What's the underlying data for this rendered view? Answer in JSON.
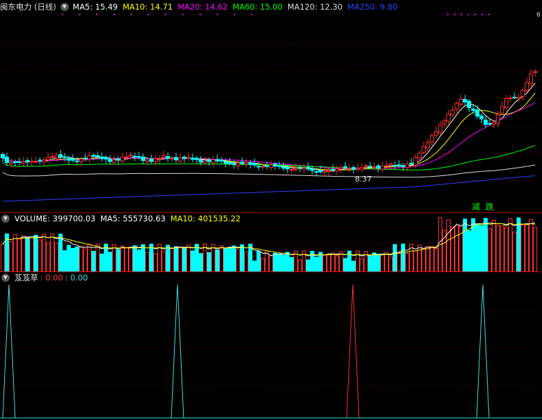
{
  "main": {
    "title": "闽东电力 (日线)",
    "indicators": [
      {
        "label": "MA5: 15.49",
        "color": "#ffffff"
      },
      {
        "label": "MA10: 14.71",
        "color": "#ffff00"
      },
      {
        "label": "MA20: 14.62",
        "color": "#ff00ff"
      },
      {
        "label": "MA60: 15.00",
        "color": "#00ff00"
      },
      {
        "label": "MA120: 12.30",
        "color": "#dddddd"
      },
      {
        "label": "MA250: 9.80",
        "color": "#3040ff"
      }
    ],
    "low_label": "8.37",
    "signal_label": "减 跌",
    "signal_color": "#00ff00",
    "high_marker": "6"
  },
  "volume": {
    "indicators": [
      {
        "label": "VOLUME: 399700.03",
        "color": "#ffffff"
      },
      {
        "label": "MA5: 555730.63",
        "color": "#ffffff"
      },
      {
        "label": "MA10: 401535.22",
        "color": "#ffff00"
      }
    ]
  },
  "indicator": {
    "name": "芨芨草",
    "values": [
      {
        "label": ": 0.00",
        "color": "#ff4040"
      },
      {
        "label": ": 0.00",
        "color": "#40e0e0"
      }
    ],
    "peaks": [
      {
        "type": "cyan"
      },
      {
        "type": "cyan"
      },
      {
        "type": "red"
      },
      {
        "type": "cyan"
      }
    ]
  },
  "colors": {
    "up": "#ff3030",
    "down": "#00ffff",
    "grid": "#8b0000",
    "ma5": "#ffffff",
    "ma10": "#ffff00",
    "ma20": "#ff00ff",
    "ma60": "#00ff00",
    "ma120": "#dddddd",
    "ma250": "#3040ff"
  }
}
